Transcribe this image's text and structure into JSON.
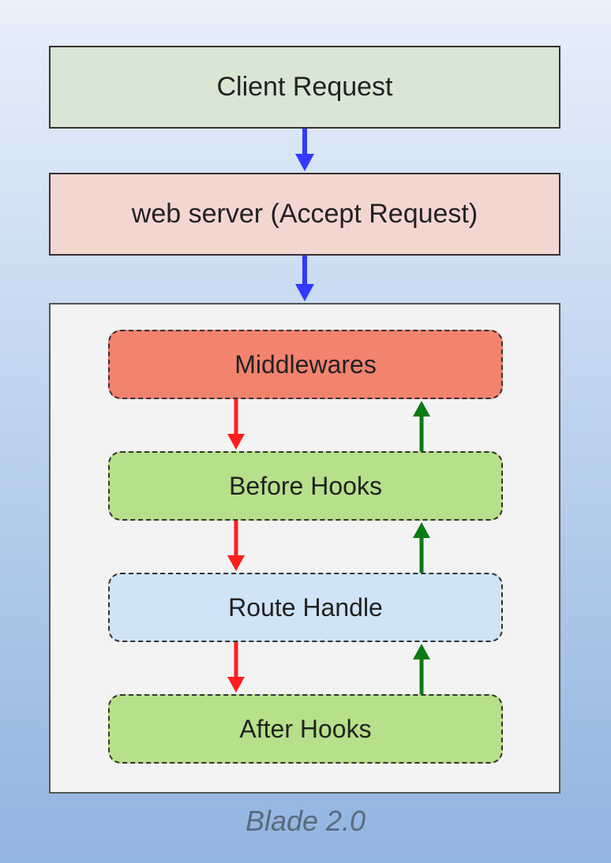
{
  "boxes": {
    "client": "Client Request",
    "server": "web server (Accept Request)"
  },
  "pills": {
    "middlewares": "Middlewares",
    "before_hooks": "Before Hooks",
    "route_handle": "Route Handle",
    "after_hooks": "After Hooks"
  },
  "caption": "Blade 2.0",
  "colors": {
    "blue_arrow": "#3339ff",
    "red_arrow": "#ff1e1e",
    "green_arrow": "#0b7a15"
  }
}
